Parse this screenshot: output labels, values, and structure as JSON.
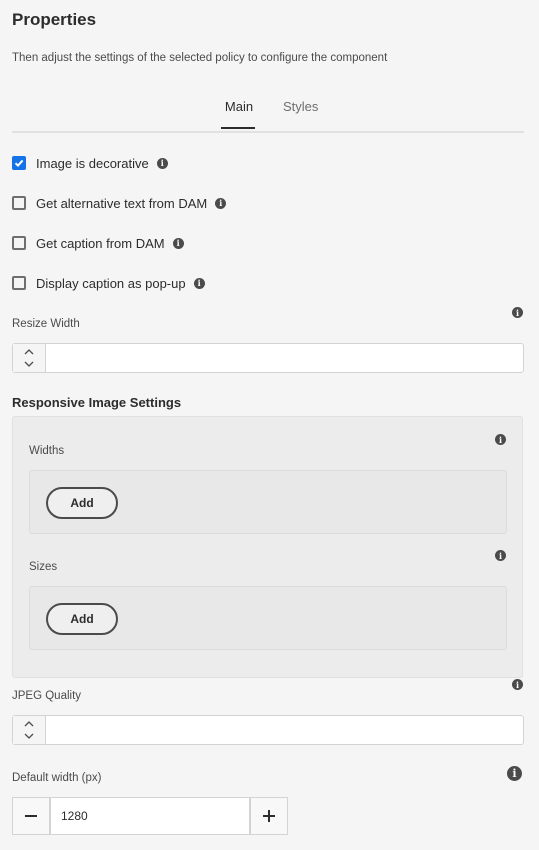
{
  "header": {
    "title": "Properties",
    "subtitle": "Then adjust the settings of the selected policy to configure the component"
  },
  "tabs": [
    {
      "label": "Main",
      "active": true
    },
    {
      "label": "Styles",
      "active": false
    }
  ],
  "options": [
    {
      "label": "Image is decorative",
      "checked": true
    },
    {
      "label": "Get alternative text from DAM",
      "checked": false
    },
    {
      "label": "Get caption from DAM",
      "checked": false
    },
    {
      "label": "Display caption as pop-up",
      "checked": false
    }
  ],
  "resize_width": {
    "label": "Resize Width",
    "value": ""
  },
  "responsive": {
    "title": "Responsive Image Settings",
    "widths": {
      "label": "Widths",
      "add_label": "Add"
    },
    "sizes": {
      "label": "Sizes",
      "add_label": "Add"
    }
  },
  "jpeg_quality": {
    "label": "JPEG Quality",
    "value": ""
  },
  "default_width": {
    "label": "Default width (px)",
    "value": "1280"
  },
  "icons": {
    "info": "i",
    "up": "^",
    "down": "v",
    "minus": "−",
    "plus": "+"
  },
  "colors": {
    "accent": "#1473e6"
  }
}
